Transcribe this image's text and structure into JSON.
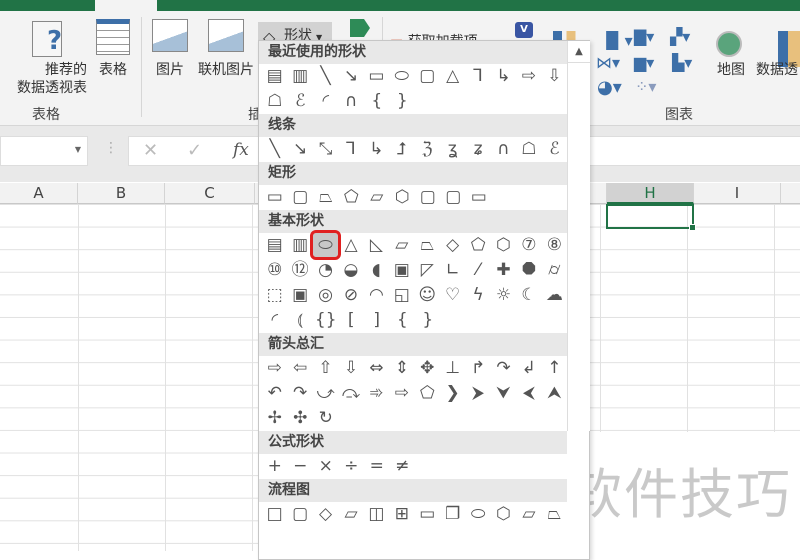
{
  "ribbon": {
    "recommended_pivot": "推荐的\n数据透视表",
    "pivot_partial": "表",
    "table": "表格",
    "table_group": "表格",
    "picture": "图片",
    "online_picture": "联机图片",
    "illustrations_group_partial": "插",
    "shapes": "形状",
    "get_addins": "获取加载项",
    "map": "地图",
    "pivot_chart": "数据透",
    "charts_group": "图表"
  },
  "formula_bar": {
    "cancel": "✕",
    "enter": "✓",
    "fx": "fx"
  },
  "columns": [
    "A",
    "B",
    "C",
    "H",
    "I"
  ],
  "shapes_menu": {
    "sections": [
      {
        "title": "最近使用的形状",
        "rows": [
          [
            "textbox",
            "vtextbox",
            "line",
            "arrow",
            "rect",
            "oval",
            "roundrect",
            "triangle",
            "elbow",
            "elbow-arrow",
            "right-arrow",
            "down-arrow"
          ],
          [
            "freeform",
            "scribble",
            "arc",
            "curve",
            "brace-left",
            "brace-right"
          ]
        ]
      },
      {
        "title": "线条",
        "rows": [
          [
            "line",
            "arrow",
            "double-arrow",
            "elbow",
            "elbow-arrow",
            "elbow-double",
            "curve-c",
            "curve-arrow",
            "curve-double",
            "curve",
            "freeform",
            "scribble"
          ]
        ]
      },
      {
        "title": "矩形",
        "rows": [
          [
            "rect",
            "roundrect",
            "snip1",
            "snip2",
            "snipdiag",
            "sniprnd",
            "rnd1",
            "rnd2",
            "rnddiag"
          ]
        ]
      },
      {
        "title": "基本形状",
        "rows": [
          [
            "textbox",
            "vtextbox",
            "oval",
            "triangle",
            "rtriangle",
            "parallelogram",
            "trapezoid",
            "diamond",
            "pentagon",
            "hexagon",
            "heptagon",
            "octagon"
          ],
          [
            "decagon",
            "dodecagon",
            "pie",
            "chord",
            "teardrop",
            "frame",
            "halfframe",
            "lshape",
            "diagstripe",
            "cross",
            "plaque",
            "can"
          ],
          [
            "cube",
            "bevel",
            "donut",
            "nosmoking",
            "blockarc",
            "foldedcorner",
            "smiley",
            "heart",
            "lightning",
            "sun",
            "moon",
            "cloud"
          ],
          [
            "arc",
            "bracketpair",
            "bracepair",
            "leftbracket",
            "rightbracket",
            "leftbrace",
            "rightbrace"
          ]
        ]
      },
      {
        "title": "箭头总汇",
        "rows": [
          [
            "right-arrow",
            "left-arrow",
            "up-arrow",
            "down-arrow",
            "lr-arrow",
            "ud-arrow",
            "quad-arrow",
            "lru-arrow",
            "bent-arrow",
            "uturn",
            "leftup",
            "bentup"
          ],
          [
            "curved-r",
            "curved-l",
            "curved-u",
            "curved-d",
            "striped",
            "notched",
            "pentagon-arrow",
            "chevron",
            "callout-r",
            "callout-d",
            "callout-l",
            "callout-u"
          ],
          [
            "callout-lr",
            "callout-quad",
            "circular"
          ]
        ]
      },
      {
        "title": "公式形状",
        "rows": [
          [
            "plus",
            "minus",
            "multiply",
            "divide",
            "equal",
            "notequal"
          ]
        ]
      },
      {
        "title": "流程图",
        "rows": [
          [
            "process",
            "altprocess",
            "decision",
            "data",
            "predefined",
            "internal",
            "document",
            "multidoc",
            "terminator",
            "preparation",
            "manualinput",
            "manualop"
          ]
        ]
      }
    ],
    "selected": "oval"
  },
  "watermark": "软件技巧"
}
